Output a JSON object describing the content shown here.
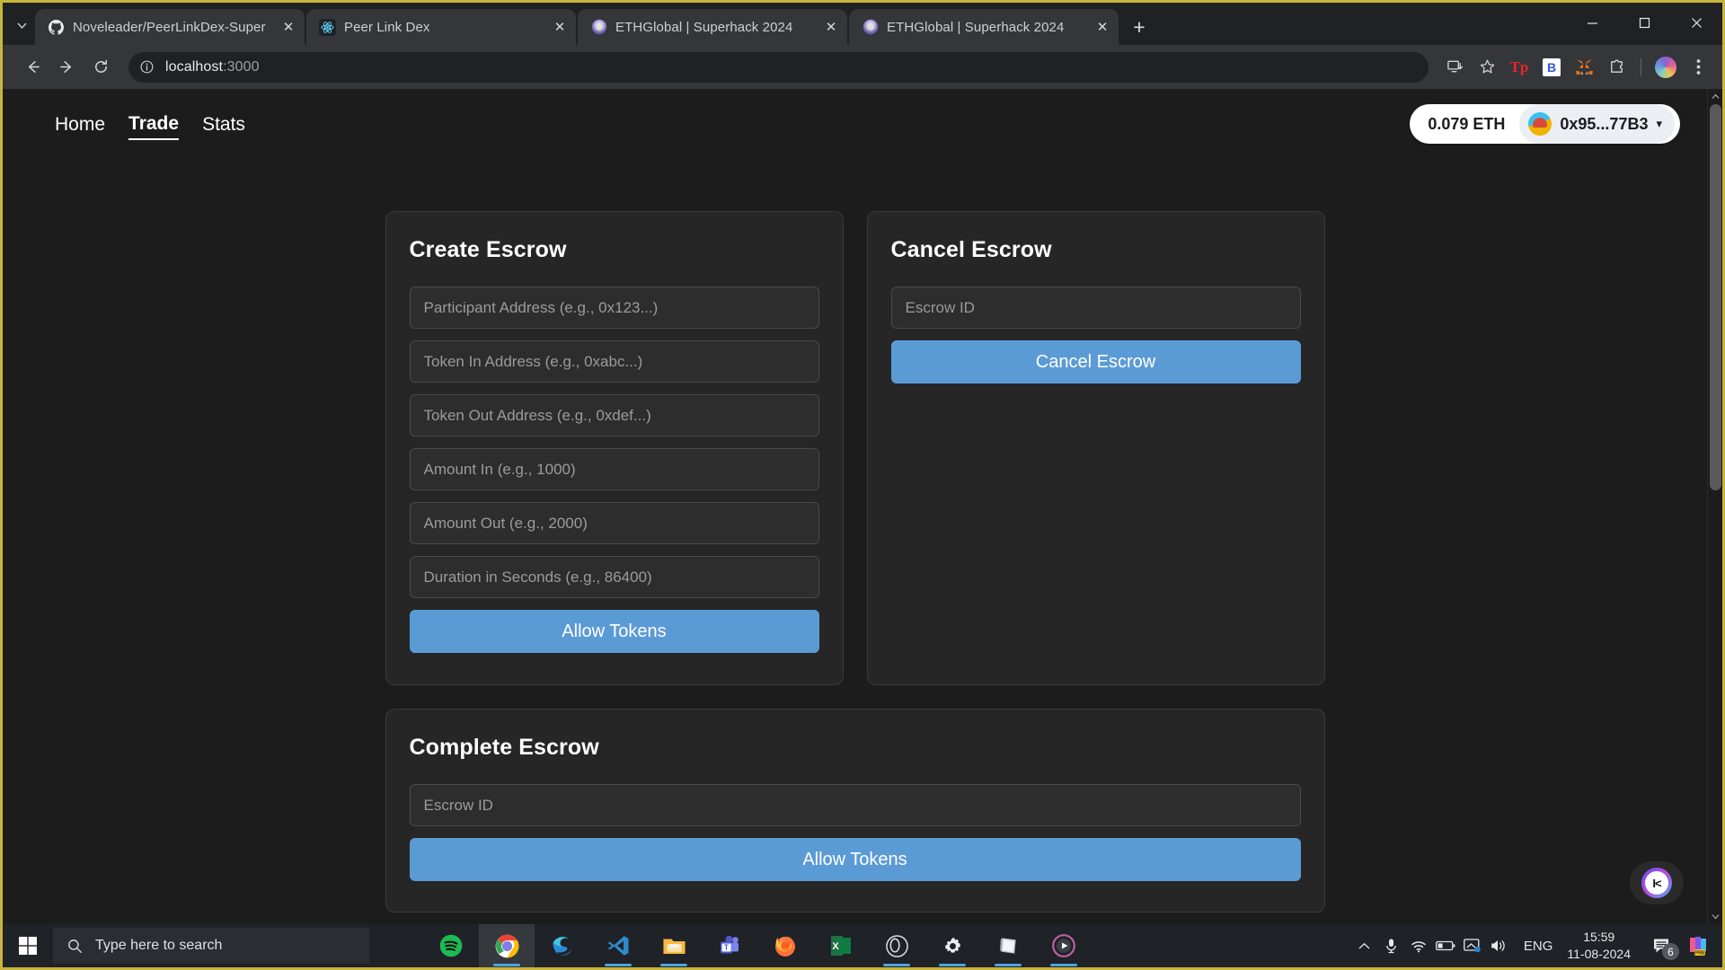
{
  "browser": {
    "tabs": [
      {
        "title": "Noveleader/PeerLinkDex-Super",
        "icon": "github-icon",
        "active": false
      },
      {
        "title": "Peer Link Dex",
        "icon": "react-icon",
        "active": true
      },
      {
        "title": "ETHGlobal | Superhack 2024",
        "icon": "ethglobal-icon",
        "active": false
      },
      {
        "title": "ETHGlobal | Superhack 2024",
        "icon": "ethglobal-icon",
        "active": false
      }
    ],
    "new_tab_label": "+",
    "close_label": "✕",
    "window_controls": {
      "minimize": "—",
      "maximize": "□",
      "close": "✕"
    },
    "toolbar": {
      "back": "back-icon",
      "forward": "forward-icon",
      "reload": "reload-icon",
      "url_host": "localhost",
      "url_port": ":3000",
      "icons": [
        "install-icon",
        "bookmark-star-icon",
        "tp-extension-icon",
        "b-extension-icon",
        "metamask-icon",
        "extensions-puzzle-icon",
        "profile-avatar",
        "chrome-menu-icon"
      ],
      "ext_tp_label": "Tp",
      "ext_b_label": "B"
    }
  },
  "site": {
    "nav": [
      {
        "label": "Home",
        "active": false
      },
      {
        "label": "Trade",
        "active": true
      },
      {
        "label": "Stats",
        "active": false
      }
    ],
    "wallet": {
      "balance": "0.079 ETH",
      "address": "0x95...77B3",
      "chevron": "▾"
    },
    "cards": {
      "create_escrow": {
        "title": "Create Escrow",
        "fields": [
          {
            "name": "participant-address",
            "placeholder": "Participant Address (e.g., 0x123...)",
            "value": ""
          },
          {
            "name": "token-in-address",
            "placeholder": "Token In Address (e.g., 0xabc...)",
            "value": ""
          },
          {
            "name": "token-out-address",
            "placeholder": "Token Out Address (e.g., 0xdef...)",
            "value": ""
          },
          {
            "name": "amount-in",
            "placeholder": "Amount In (e.g., 1000)",
            "value": ""
          },
          {
            "name": "amount-out",
            "placeholder": "Amount Out (e.g., 2000)",
            "value": ""
          },
          {
            "name": "duration-seconds",
            "placeholder": "Duration in Seconds (e.g., 86400)",
            "value": ""
          }
        ],
        "button": "Allow Tokens"
      },
      "cancel_escrow": {
        "title": "Cancel Escrow",
        "fields": [
          {
            "name": "escrow-id",
            "placeholder": "Escrow ID",
            "value": ""
          }
        ],
        "button": "Cancel Escrow"
      },
      "complete_escrow": {
        "title": "Complete Escrow",
        "fields": [
          {
            "name": "escrow-id",
            "placeholder": "Escrow ID",
            "value": ""
          }
        ],
        "button": "Allow Tokens"
      }
    },
    "chat_widget": "chat-bubble-icon",
    "accent_color": "#5b9bd5",
    "card_bg": "#262626",
    "page_bg": "#1c1c1c"
  },
  "taskbar": {
    "start": "windows-start-icon",
    "search_placeholder": "Type here to search",
    "apps": [
      {
        "name": "spotify",
        "running": false,
        "active": false
      },
      {
        "name": "google-chrome",
        "running": true,
        "active": true
      },
      {
        "name": "microsoft-edge",
        "running": false,
        "active": false
      },
      {
        "name": "visual-studio-code",
        "running": true,
        "active": false
      },
      {
        "name": "file-explorer",
        "running": true,
        "active": false
      },
      {
        "name": "microsoft-teams",
        "running": false,
        "active": false
      },
      {
        "name": "mozilla-firefox",
        "running": false,
        "active": false
      },
      {
        "name": "microsoft-excel",
        "running": false,
        "active": false
      },
      {
        "name": "obs-studio",
        "running": true,
        "active": false
      },
      {
        "name": "settings",
        "running": true,
        "active": false
      },
      {
        "name": "sticky-notes",
        "running": true,
        "active": false
      },
      {
        "name": "media-player",
        "running": true,
        "active": false
      }
    ],
    "tray": {
      "chevron": "show-hidden-icons",
      "icons": [
        "microphone-icon",
        "wifi-icon",
        "battery-icon",
        "display-cast-icon",
        "volume-icon"
      ],
      "language": "ENG",
      "time": "15:59",
      "date": "11-08-2024",
      "notification_count": "6",
      "copilot": "copilot-pre-icon"
    }
  }
}
